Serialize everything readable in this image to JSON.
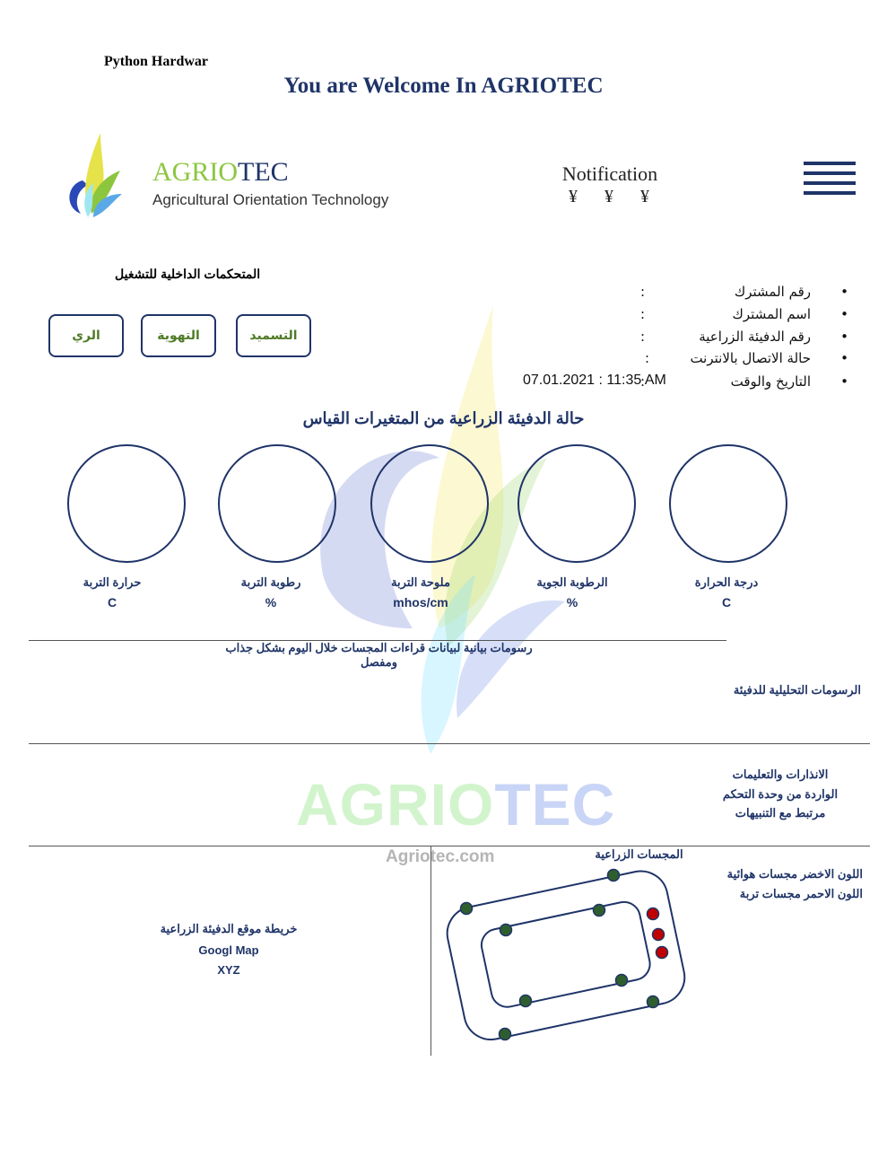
{
  "header": {
    "top_label": "Python Hardwar",
    "welcome": "You are Welcome In AGRIOTEC"
  },
  "brand": {
    "name_part1": "AGRIO",
    "name_part2": "TEC",
    "subtitle": "Agricultural Orientation Technology",
    "logo_icon": "leaf-flame-logo-icon"
  },
  "notification": {
    "title": "Notification",
    "symbols": [
      "¥",
      "¥",
      "¥"
    ]
  },
  "menu": {
    "icon": "hamburger-menu-icon"
  },
  "controls": {
    "title": "المتحكمات الداخلية للتشغيل",
    "buttons": [
      "الري",
      "التهوية",
      "التسميد"
    ]
  },
  "info": {
    "bullet": "•",
    "colon": ":",
    "rows": [
      "رقم المشترك",
      "اسم المشترك",
      "رقم الدفيئة الزراعية",
      "حالة الاتصال بالانترنت",
      "التاريخ والوقت"
    ],
    "datetime_value": "07.01.2021 : 11:35 AM"
  },
  "status": {
    "title": "حالة الدفيئة الزراعية من المتغيرات القياس",
    "gauges": [
      {
        "label": "حرارة التربة",
        "unit": "C"
      },
      {
        "label": "رطوبة التربة",
        "unit": "%"
      },
      {
        "label": "ملوحة التربة",
        "unit": "mhos/cm"
      },
      {
        "label": "الرطوبة الجوية",
        "unit": "%"
      },
      {
        "label": "درجة الحرارة",
        "unit": "C"
      }
    ]
  },
  "charts_section": {
    "caption": "رسومات بيانية لبيانات قراءات المجسات خلال اليوم  بشكل جذاب ومفصل",
    "label": "الرسومات التحليلية للدفيئة"
  },
  "alerts_section": {
    "lines": [
      "الانذارات والتعليمات",
      "الواردة من وحدة التحكم",
      "مرتبط مع التنبيهات"
    ]
  },
  "sensors_section": {
    "title": "المجسات الزراعية",
    "legend": [
      "اللون الاخضر مجسات هوائية",
      "اللون الاحمر مجسات تربة"
    ],
    "colors": {
      "air": "#2e5e2e",
      "soil": "#c00000"
    }
  },
  "map_section": {
    "lines": [
      "خريطة موقع الدفيئة الزراعية",
      "Googl Map",
      "XYZ"
    ]
  },
  "watermark": {
    "name_part1": "AGRIO",
    "name_part2": "TEC",
    "url": "Agriotec.com"
  }
}
